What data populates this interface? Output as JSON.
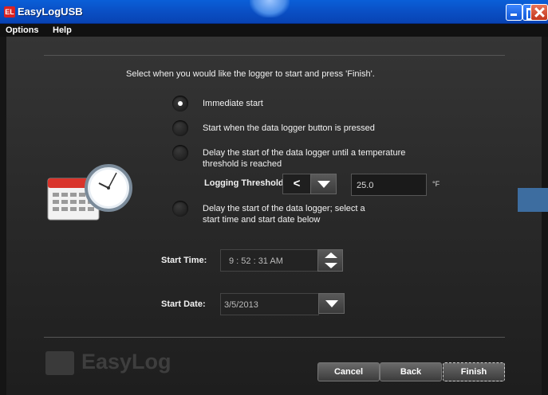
{
  "window": {
    "title": "EasyLogUSB",
    "icon_glyph": "EL",
    "controls": [
      "minimize-icon",
      "maximize-icon",
      "close-icon"
    ]
  },
  "menu": [
    "Options",
    "Help"
  ],
  "instruction": "Select when you would like the logger to start and press 'Finish'.",
  "start_options": [
    {
      "label": "Immediate start",
      "selected": true
    },
    {
      "label": "Start when the data logger button is pressed",
      "selected": false
    },
    {
      "label": "Delay the start of the data logger until a temperature threshold is reached",
      "selected": false
    },
    {
      "label": "Delay the start of the data logger; select a start time and start date below",
      "selected": false
    }
  ],
  "threshold": {
    "label": "Logging Threshold",
    "operator": "<",
    "value": "25.0",
    "unit": "°F"
  },
  "start_time": {
    "label": "Start Time:",
    "value": "9 : 52 : 31 AM"
  },
  "start_date": {
    "label": "Start Date:",
    "value": "3/5/2013"
  },
  "brand": "EasyLog",
  "buttons": {
    "cancel": "Cancel",
    "back": "Back",
    "finish": "Finish"
  },
  "colors": {
    "title_bar": "#0a4fc4",
    "panel": "#2b2b2b",
    "accent": "#3d6da0"
  },
  "icons": {
    "schedule": "calendar-clock-icon"
  }
}
